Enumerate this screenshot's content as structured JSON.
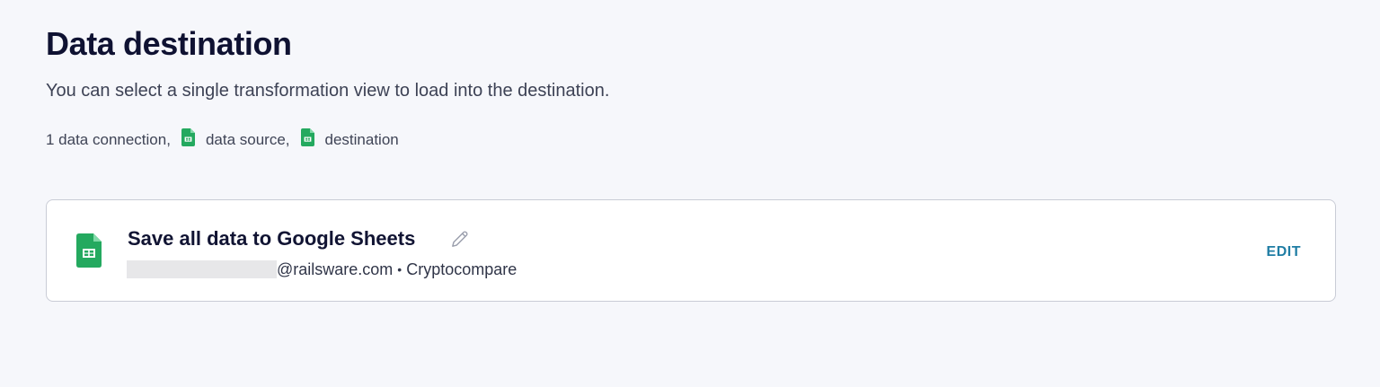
{
  "header": {
    "title": "Data destination",
    "subtitle": "You can select a single transformation view to load into the destination."
  },
  "summary": {
    "connections_text": "1 data connection,",
    "source_text": "data source,",
    "destination_text": "destination",
    "source_icon": "google-sheets-icon",
    "destination_icon": "google-sheets-icon"
  },
  "destination_card": {
    "icon": "google-sheets-icon",
    "title": "Save all data to Google Sheets",
    "rename_icon": "pencil-icon",
    "email_suffix": "@railsware.com",
    "separator": "•",
    "connector": "Cryptocompare",
    "edit_label": "EDIT"
  },
  "colors": {
    "background": "#f6f7fb",
    "card_background": "#ffffff",
    "sheets_green": "#24a95f",
    "accent_link": "#1f7da4",
    "title_text": "#0f1232"
  }
}
